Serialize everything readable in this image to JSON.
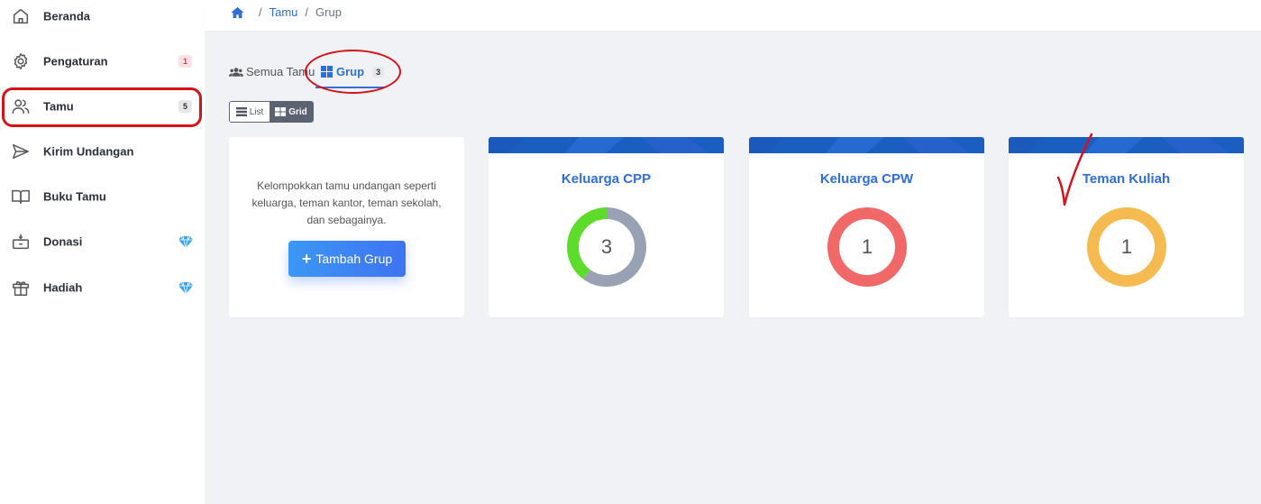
{
  "sidebar": {
    "items": [
      {
        "label": "Beranda",
        "icon": "home-icon"
      },
      {
        "label": "Pengaturan",
        "icon": "gear-icon",
        "badge": "1"
      },
      {
        "label": "Tamu",
        "icon": "users-icon",
        "badge": "5"
      },
      {
        "label": "Kirim Undangan",
        "icon": "send-icon"
      },
      {
        "label": "Buku Tamu",
        "icon": "book-icon"
      },
      {
        "label": "Donasi",
        "icon": "donation-box-icon",
        "premium_icon": "diamond-icon"
      },
      {
        "label": "Hadiah",
        "icon": "gift-icon",
        "premium_icon": "diamond-icon"
      }
    ]
  },
  "breadcrumb": {
    "home_icon": "home-icon",
    "items": [
      "Tamu",
      "Grup"
    ]
  },
  "tabs": {
    "all": {
      "label": "Semua Tamu",
      "icon": "users-icon"
    },
    "group": {
      "label": "Grup",
      "icon": "grid-icon",
      "count": "3"
    }
  },
  "view_toggle": {
    "list_label": "List",
    "grid_label": "Grid",
    "active": "Grid"
  },
  "intro_card": {
    "description": "Kelompokkan tamu undangan seperti keluarga, teman kantor, teman sekolah, dan sebagainya.",
    "button_label": "Tambah Grup"
  },
  "groups": [
    {
      "name": "Keluarga CPP",
      "count": "3",
      "segments": [
        {
          "fraction": 0.6,
          "color": "#99a2b4"
        },
        {
          "fraction": 0.4,
          "color": "#5ddc2c"
        }
      ]
    },
    {
      "name": "Keluarga CPW",
      "count": "1",
      "segments": [
        {
          "fraction": 1,
          "color": "#f06868"
        }
      ]
    },
    {
      "name": "Teman Kuliah",
      "count": "1",
      "segments": [
        {
          "fraction": 1,
          "color": "#f5ba50"
        }
      ]
    }
  ],
  "colors": {
    "accent": "#2f6fd6",
    "annotation": "#d6111a",
    "band": "#1a5ec2"
  }
}
